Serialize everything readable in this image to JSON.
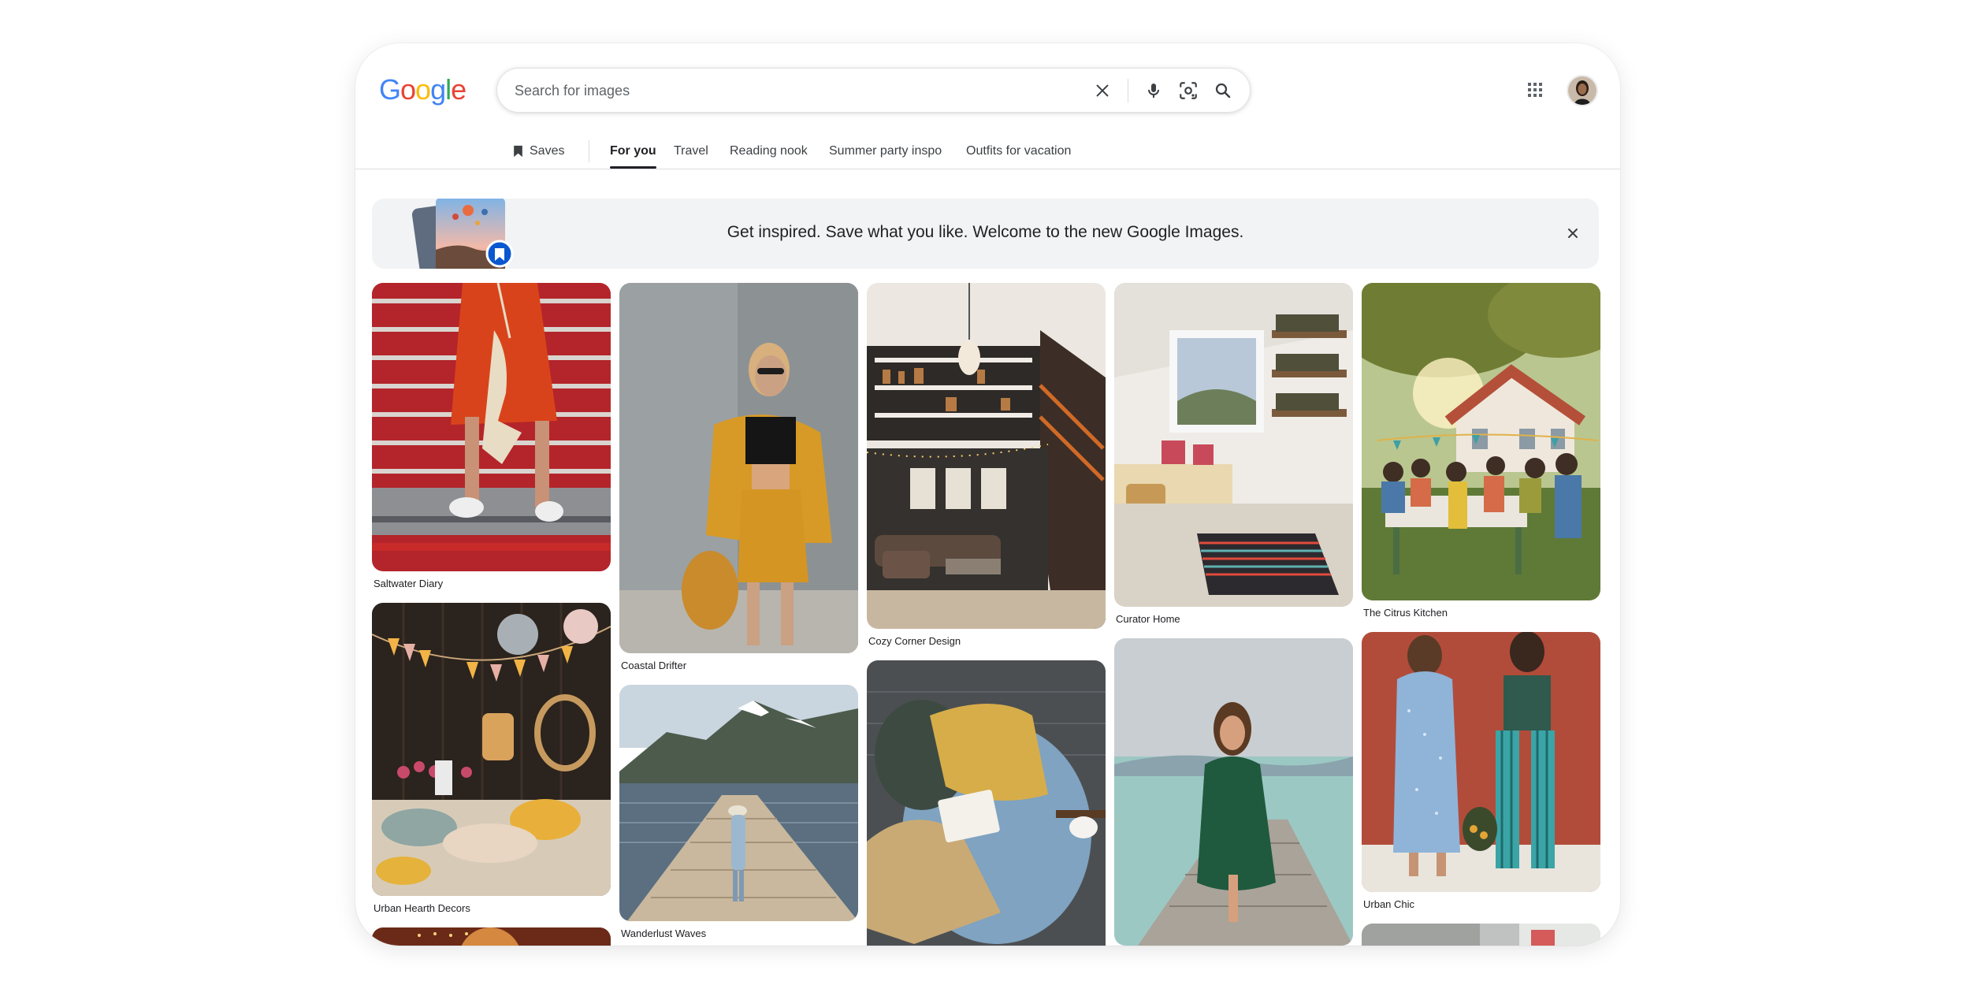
{
  "logo": {
    "letters": [
      "G",
      "o",
      "o",
      "g",
      "l",
      "e"
    ],
    "colors": [
      "#4285F4",
      "#EA4335",
      "#FBBC05",
      "#4285F4",
      "#34A853",
      "#EA4335"
    ]
  },
  "search": {
    "placeholder": "Search for images",
    "value": "",
    "icons": [
      "close-icon",
      "mic-icon",
      "lens-icon",
      "search-icon"
    ]
  },
  "header_icons": [
    "apps-icon",
    "avatar"
  ],
  "tabs": {
    "saves": "Saves",
    "items": [
      "For you",
      "Travel",
      "Reading nook",
      "Summer party inspo",
      "Outfits for vacation"
    ],
    "active_index": 0
  },
  "banner": {
    "text": "Get inspired. Save what you like. Welcome to the new Google Images.",
    "close_icon": "close-icon"
  },
  "cards": [
    {
      "caption": "Saltwater Diary"
    },
    {
      "caption": "Urban Hearth Decors"
    },
    {
      "caption": ""
    },
    {
      "caption": "Coastal Drifter"
    },
    {
      "caption": "Wanderlust Waves"
    },
    {
      "caption": "Cozy Corner Design"
    },
    {
      "caption": ""
    },
    {
      "caption": "Curator Home"
    },
    {
      "caption": ""
    },
    {
      "caption": "The Citrus Kitchen"
    },
    {
      "caption": "Urban Chic"
    },
    {
      "caption": ""
    }
  ],
  "colors": {
    "accent": "#1a73e8",
    "text": "#202124",
    "banner_bg": "#f1f3f4"
  }
}
